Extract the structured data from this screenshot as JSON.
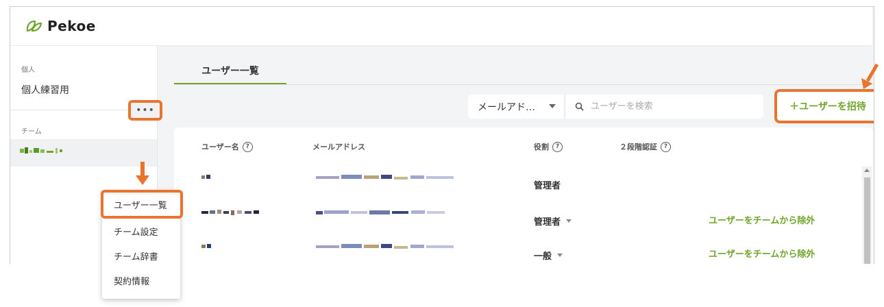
{
  "app": {
    "name": "Pekoe"
  },
  "sidebar": {
    "personal_label": "個人",
    "personal_item": "個人練習用",
    "team_label": "チーム",
    "more_label": "•••"
  },
  "main": {
    "tab_label": "ユーザー一覧",
    "filter": {
      "selected": "メールアド…"
    },
    "search": {
      "placeholder": "ユーザーを検索"
    },
    "invite_label": "＋ユーザーを招待",
    "table": {
      "headers": [
        "ユーザー名",
        "メールアドレス",
        "役割",
        "２段階認証"
      ],
      "rows": [
        {
          "role": "管理者",
          "role_editable": false,
          "action": ""
        },
        {
          "role": "管理者",
          "role_editable": true,
          "action": "ユーザーをチームから除外"
        },
        {
          "role": "一般",
          "role_editable": true,
          "action": "ユーザーをチームから除外"
        }
      ]
    }
  },
  "menu": {
    "items": [
      "ユーザー一覧",
      "チーム設定",
      "チーム辞書",
      "契約情報"
    ]
  },
  "colors": {
    "accent": "#6fa52b",
    "highlight": "#e8742e"
  }
}
